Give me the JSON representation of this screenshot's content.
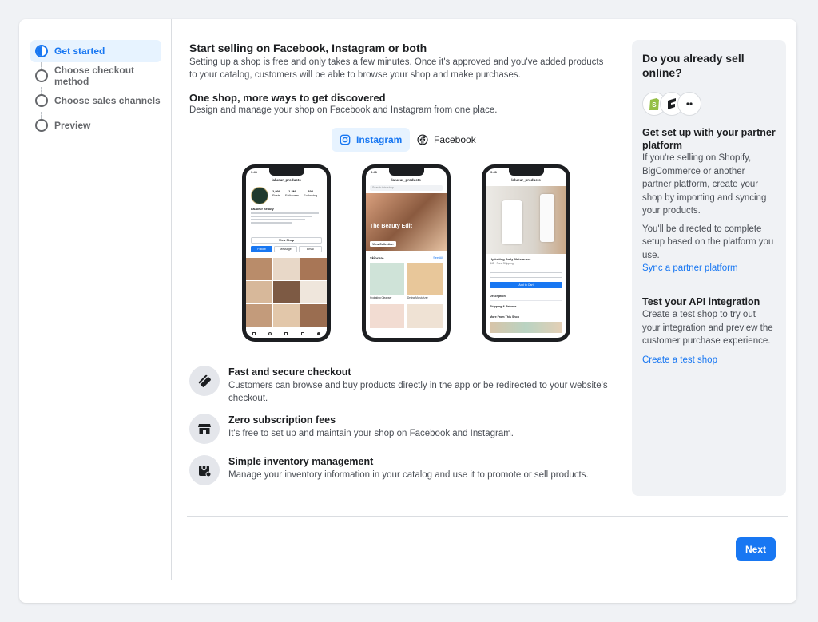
{
  "steps": [
    {
      "label": "Get started",
      "state": "active"
    },
    {
      "label": "Choose checkout method",
      "state": "pending"
    },
    {
      "label": "Choose sales channels",
      "state": "pending"
    },
    {
      "label": "Preview",
      "state": "pending"
    }
  ],
  "main": {
    "title": "Start selling on Facebook, Instagram or both",
    "intro": "Setting up a shop is free and only takes a few minutes. Once it's approved and you've added products to your catalog, customers will be able to browse your shop and make purchases.",
    "subtitle": "One shop, more ways to get discovered",
    "subtitle_desc": "Design and manage your shop on Facebook and Instagram from one place.",
    "tabs": [
      {
        "label": "Instagram",
        "icon": "instagram-icon",
        "active": true
      },
      {
        "label": "Facebook",
        "icon": "facebook-icon",
        "active": false
      }
    ]
  },
  "phones": {
    "phone1": {
      "time": "9:41",
      "account": "lalueur_products",
      "posts": "2,998",
      "posts_label": "Posts",
      "followers": "1.3M",
      "followers_label": "Followers",
      "following": "398",
      "following_label": "Following",
      "brand": "LaLueur Beauty",
      "view_shop": "View Shop",
      "follow": "Follow",
      "message": "Message",
      "email": "Email"
    },
    "phone2": {
      "time": "9:41",
      "account": "lalueur_products",
      "search_placeholder": "Search this shop",
      "hero_title": "The Beauty Edit",
      "hero_button": "View Collection",
      "section": "Skincare",
      "see_all": "See All",
      "p1": "Hydrating Cleanser",
      "p2": "Drying Moisturizer"
    },
    "phone3": {
      "time": "9:41",
      "account": "lalueur_products",
      "product": "Hydrating Daily Moisturizer",
      "price": "$45 · Free Shipping",
      "add_to_cart": "Add to Cart",
      "rows": [
        "Description",
        "Shipping & Returns",
        "More From This Shop"
      ]
    }
  },
  "features": [
    {
      "icon": "credit-card-icon",
      "title": "Fast and secure checkout",
      "desc": "Customers can browse and buy products directly in the app or be redirected to your website's checkout."
    },
    {
      "icon": "storefront-icon",
      "title": "Zero subscription fees",
      "desc": "It's free to set up and maintain your shop on Facebook and Instagram."
    },
    {
      "icon": "inventory-icon",
      "title": "Simple inventory management",
      "desc": "Manage your inventory information in your catalog and use it to promote or sell products."
    }
  ],
  "next_label": "Next",
  "panel": {
    "title": "Do you already sell online?",
    "partner_title": "Get set up with your partner platform",
    "partner_desc": "If you're selling on Shopify, BigCommerce or another partner platform, create your shop by importing and syncing your products.",
    "partner_note": "You'll be directed to complete setup based on the platform you use.",
    "partner_link": "Sync a partner platform",
    "api_title": "Test your API integration",
    "api_desc": "Create a test shop to try out your integration and preview the customer purchase experience.",
    "api_link": "Create a test shop",
    "logos": [
      "shopify-logo",
      "bigcommerce-logo",
      "more-platforms-logo"
    ]
  },
  "colors": {
    "accent": "#1877f2",
    "accent_bg": "#e7f3ff",
    "panel_bg": "#f0f2f5"
  }
}
